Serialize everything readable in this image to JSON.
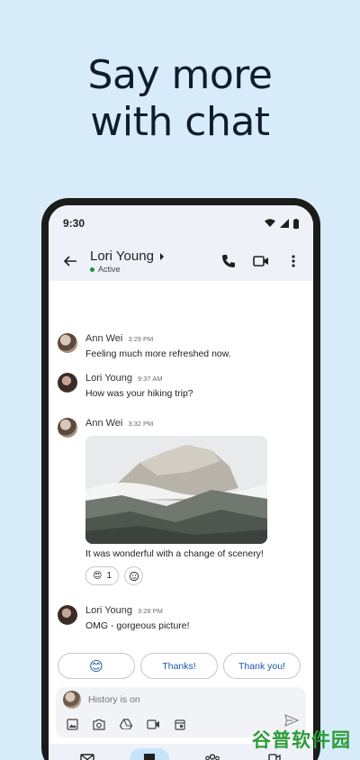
{
  "headline": {
    "line1": "Say more",
    "line2": "with chat"
  },
  "status": {
    "time": "9:30"
  },
  "chat": {
    "contact_name": "Lori Young",
    "presence": "Active"
  },
  "messages": [
    {
      "sender": "Ann Wei",
      "time": "3:29 PM",
      "text": "Feeling much more refreshed now."
    },
    {
      "sender": "Lori Young",
      "time": "9:37 AM",
      "text": "How was your hiking trip?"
    },
    {
      "sender": "Ann Wei",
      "time": "3:32 PM",
      "text": "It was wonderful with a change of scenery!",
      "reaction_emoji": "😍",
      "reaction_count": "1"
    },
    {
      "sender": "Lori Young",
      "time": "3:28 PM",
      "text": "OMG - gorgeous picture!"
    }
  ],
  "smart_replies": {
    "emoji": "😊",
    "thanks": "Thanks!",
    "thank_you": "Thank you!"
  },
  "compose": {
    "placeholder": "History is on"
  },
  "watermark": "谷普软件园",
  "colors": {
    "background": "#d7ecf8",
    "accent": "#1a56b0",
    "active_nav": "#c5e4f9",
    "presence": "#1e8e3e"
  }
}
